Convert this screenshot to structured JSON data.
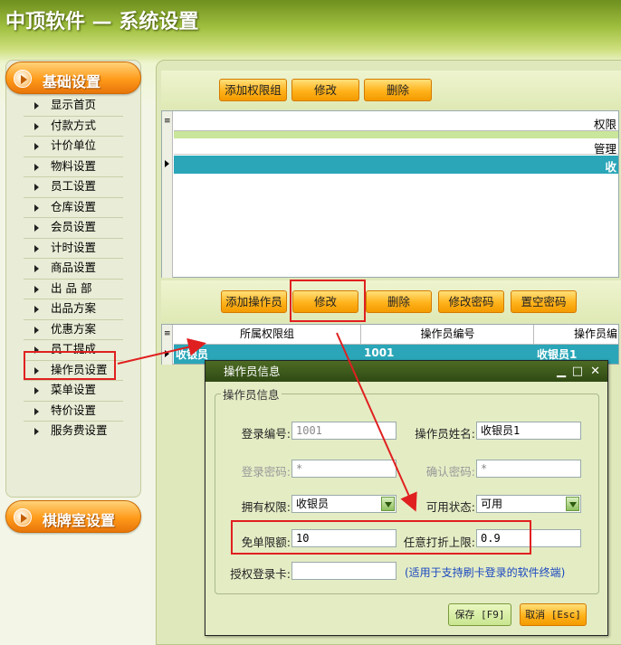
{
  "header": {
    "title": "中顶软件 — 系统设置"
  },
  "sidebar": {
    "section1": "基础设置",
    "items": [
      "显示首页",
      "付款方式",
      "计价单位",
      "物料设置",
      "员工设置",
      "仓库设置",
      "会员设置",
      "计时设置",
      "商品设置",
      "出 品 部",
      "出品方案",
      "优惠方案",
      "员工提成",
      "操作员设置",
      "菜单设置",
      "特价设置",
      "服务费设置"
    ],
    "section2": "棋牌室设置"
  },
  "top_toolbar": {
    "add_group": "添加权限组",
    "edit": "修改",
    "delete": "删除"
  },
  "group_grid": {
    "header_partial": "权限",
    "row1_partial": "管理",
    "row2_partial": "收"
  },
  "op_toolbar": {
    "add_operator": "添加操作员",
    "edit": "修改",
    "delete": "删除",
    "change_pwd": "修改密码",
    "reset_pwd": "置空密码"
  },
  "op_grid": {
    "columns": [
      "所属权限组",
      "操作员编号",
      "操作员编"
    ],
    "row": [
      "收银员",
      "1001",
      "收银员1"
    ]
  },
  "dialog": {
    "title": "操作员信息",
    "group_title": "操作员信息",
    "login_no_label": "登录编号:",
    "login_no": "1001",
    "name_label": "操作员姓名:",
    "name": "收银员1",
    "pwd_label": "登录密码:",
    "pwd": "*",
    "confirm_label": "确认密码:",
    "confirm": "*",
    "perm_label": "拥有权限:",
    "perm": "收银员",
    "status_label": "可用状态:",
    "status": "可用",
    "free_label": "免单限额:",
    "free": "10",
    "discount_label": "任意打折上限:",
    "discount": "0.9",
    "card_label": "授权登录卡:",
    "card_note": "(适用于支持刷卡登录的软件终端)",
    "save": "保存 [F9]",
    "cancel": "取消 [Esc]"
  },
  "colors": {
    "accent_orange": "#ff9a1a",
    "selected_row": "#2aa6b8",
    "highlight_red": "#e02020"
  }
}
